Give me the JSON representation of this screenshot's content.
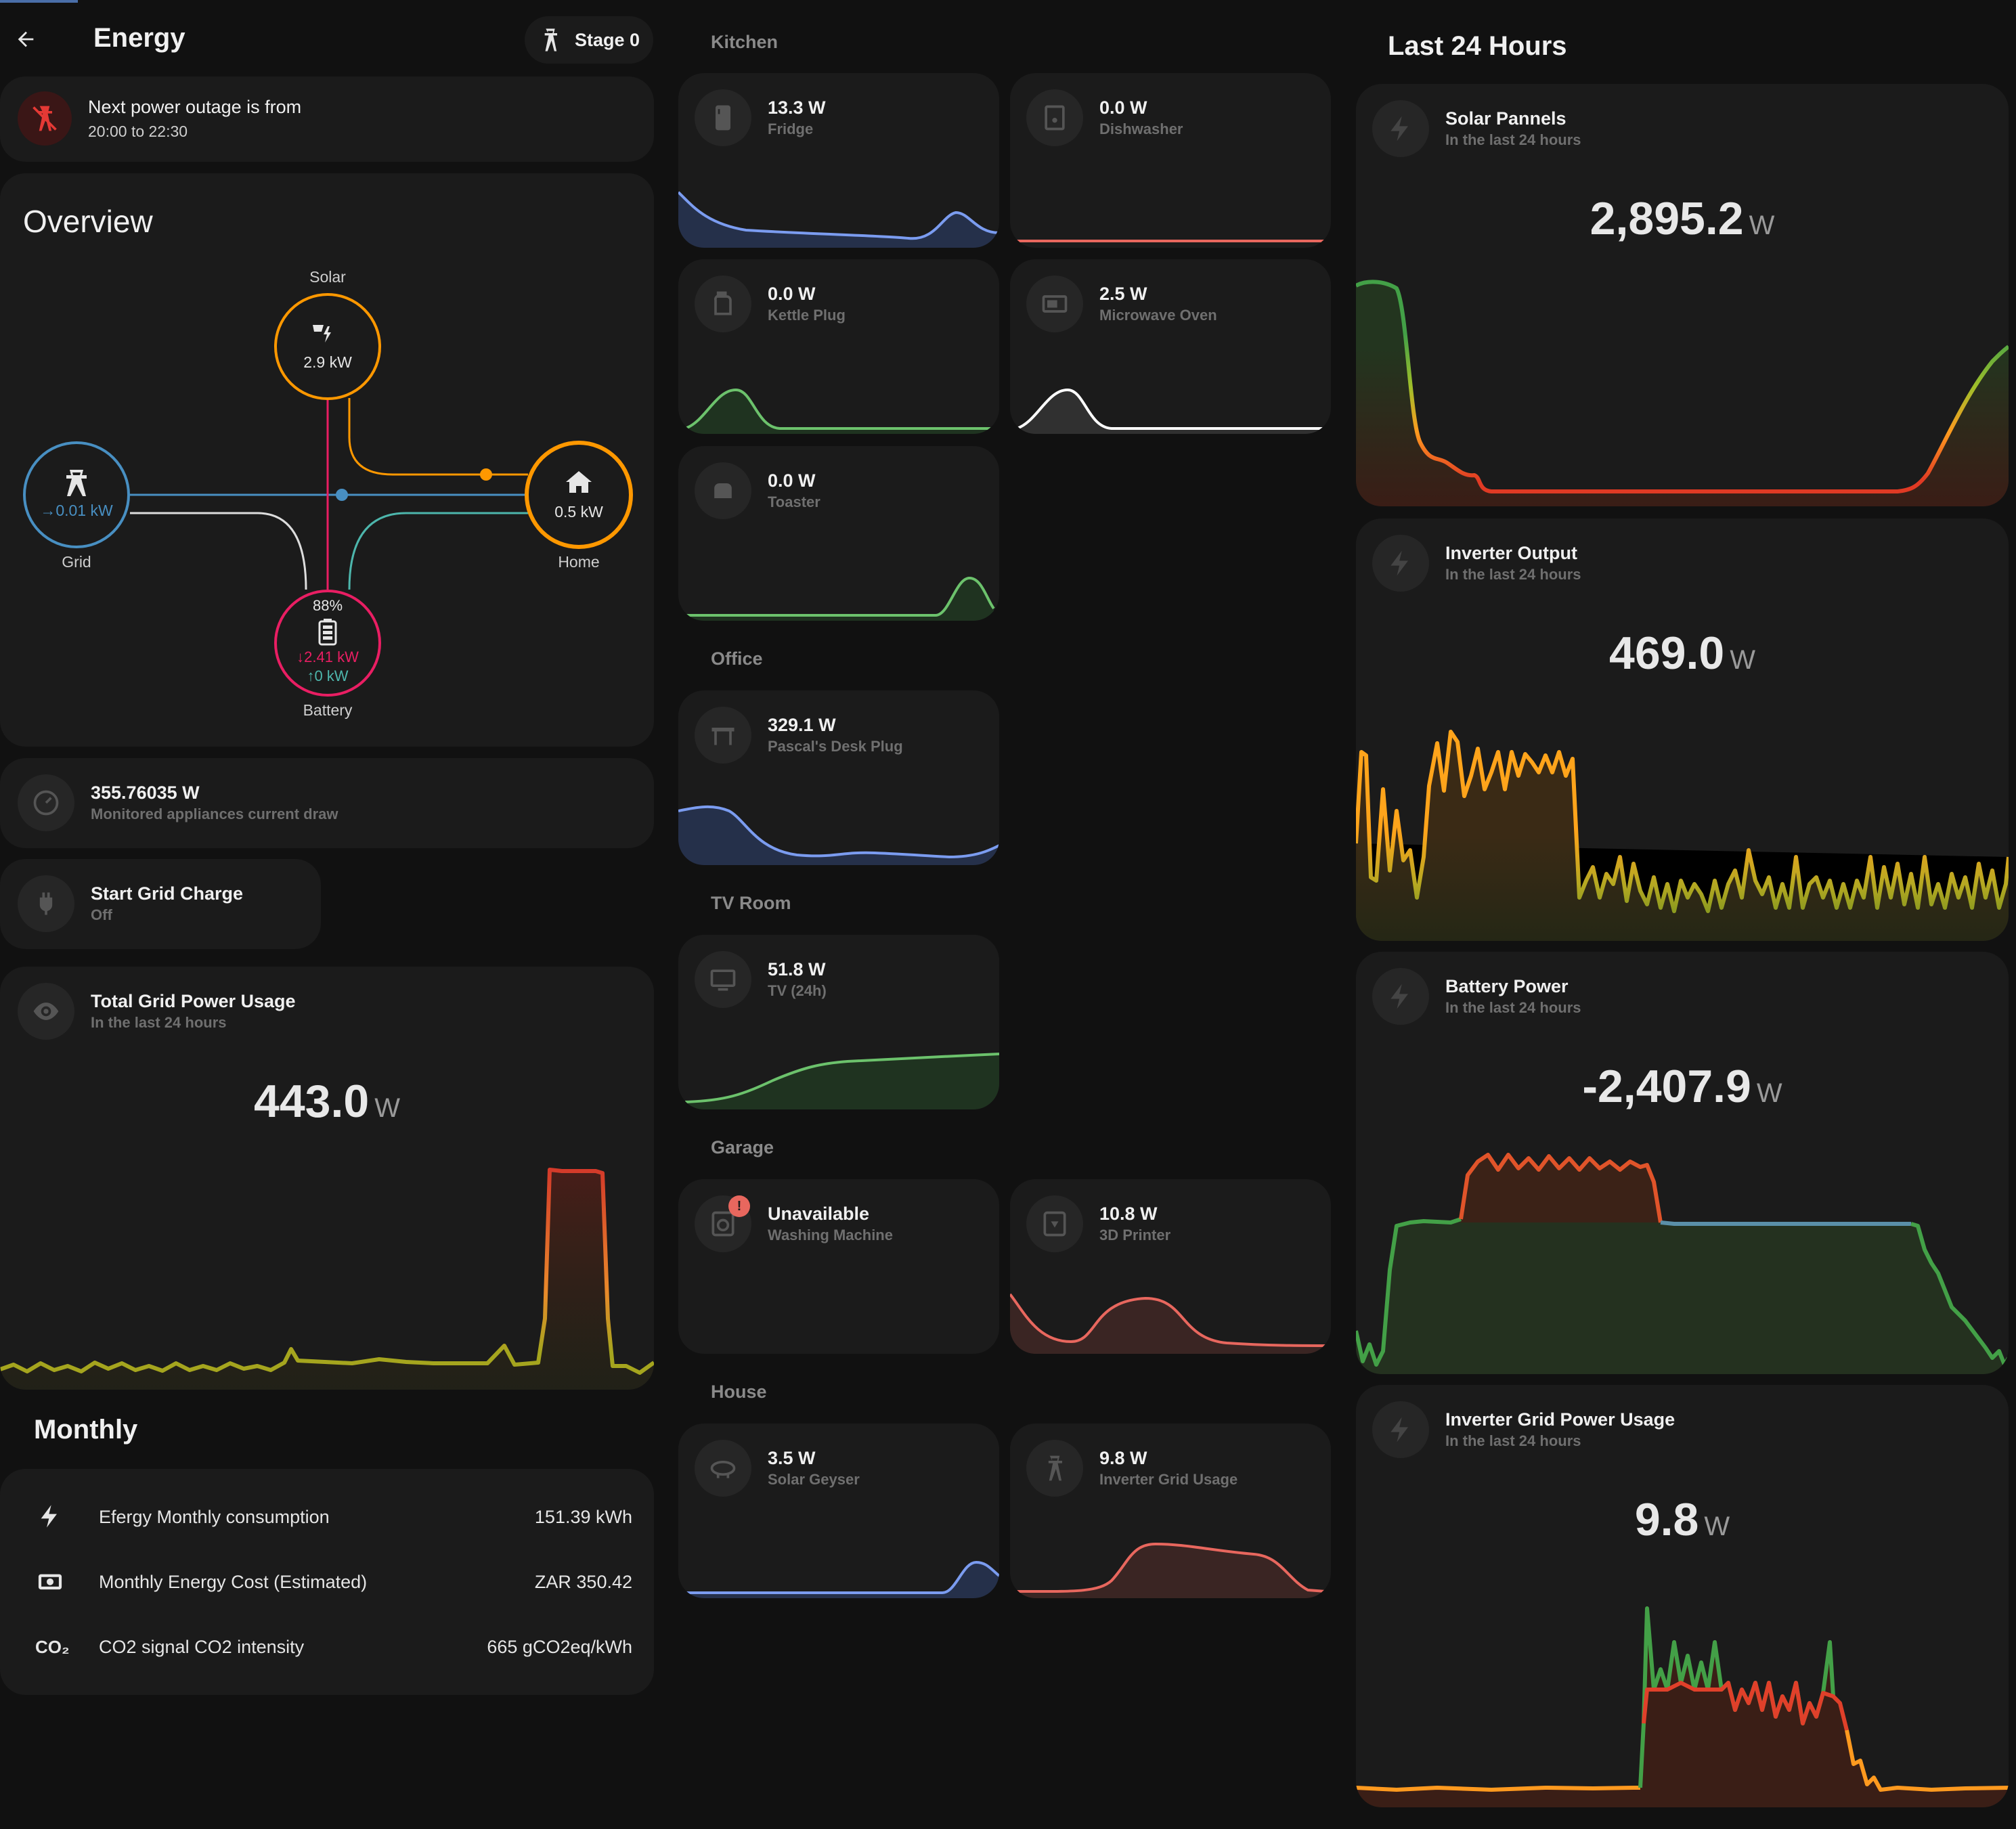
{
  "header": {
    "title": "Energy",
    "stage_label": "Stage 0"
  },
  "outage": {
    "title": "Next power outage is from",
    "time": "20:00 to 22:30"
  },
  "overview": {
    "title": "Overview",
    "solar": {
      "label": "Solar",
      "value": "2.9 kW"
    },
    "grid": {
      "label": "Grid",
      "value": "→0.01 kW"
    },
    "home": {
      "label": "Home",
      "value": "0.5 kW"
    },
    "battery": {
      "label": "Battery",
      "percent": "88%",
      "out": "↓2.41 kW",
      "in": "↑0 kW"
    }
  },
  "monitored": {
    "value": "355.76035 W",
    "label": "Monitored appliances current draw"
  },
  "grid_charge": {
    "title": "Start Grid Charge",
    "state": "Off"
  },
  "total_grid": {
    "title": "Total Grid Power Usage",
    "subtitle": "In the last 24 hours",
    "value": "443.0",
    "unit": "W"
  },
  "monthly": {
    "title": "Monthly",
    "rows": [
      {
        "icon": "lightning-icon",
        "label": "Efergy Monthly consumption",
        "value": "151.39 kWh"
      },
      {
        "icon": "cash-icon",
        "label": "Monthly Energy Cost (Estimated)",
        "value": "ZAR 350.42"
      },
      {
        "icon": "co2-icon",
        "label": "CO2 signal CO2 intensity",
        "value": "665 gCO2eq/kWh"
      }
    ]
  },
  "rooms": {
    "kitchen": "Kitchen",
    "office": "Office",
    "tv_room": "TV Room",
    "garage": "Garage",
    "house": "House"
  },
  "devices": {
    "fridge": {
      "value": "13.3 W",
      "name": "Fridge"
    },
    "dishwasher": {
      "value": "0.0 W",
      "name": "Dishwasher"
    },
    "kettle": {
      "value": "0.0 W",
      "name": "Kettle Plug"
    },
    "microwave": {
      "value": "2.5 W",
      "name": "Microwave Oven"
    },
    "toaster": {
      "value": "0.0 W",
      "name": "Toaster"
    },
    "desk": {
      "value": "329.1 W",
      "name": "Pascal's Desk Plug"
    },
    "tv": {
      "value": "51.8 W",
      "name": "TV (24h)"
    },
    "washing": {
      "value": "Unavailable",
      "name": "Washing Machine",
      "badge": "!"
    },
    "printer": {
      "value": "10.8 W",
      "name": "3D Printer"
    },
    "geyser": {
      "value": "3.5 W",
      "name": "Solar Geyser"
    },
    "inverter_grid_dev": {
      "value": "9.8 W",
      "name": "Inverter Grid Usage"
    }
  },
  "last24": {
    "title": "Last 24 Hours",
    "cards": [
      {
        "title": "Solar Pannels",
        "subtitle": "In the last 24 hours",
        "value": "2,895.2",
        "unit": "W"
      },
      {
        "title": "Inverter Output",
        "subtitle": "In the last 24 hours",
        "value": "469.0",
        "unit": "W"
      },
      {
        "title": "Battery Power",
        "subtitle": "In the last 24 hours",
        "value": "-2,407.9",
        "unit": "W"
      },
      {
        "title": "Inverter Grid Power Usage",
        "subtitle": "In the last 24 hours",
        "value": "9.8",
        "unit": "W"
      }
    ]
  },
  "colors": {
    "solar": "#ff9800",
    "grid": "#488fc2",
    "battery": "#e91e63",
    "home": "#ff9800",
    "blue_line": "#7b9cf0",
    "green_line": "#6cc26c",
    "red_line": "#e8675e",
    "white_line": "#ffffff"
  }
}
